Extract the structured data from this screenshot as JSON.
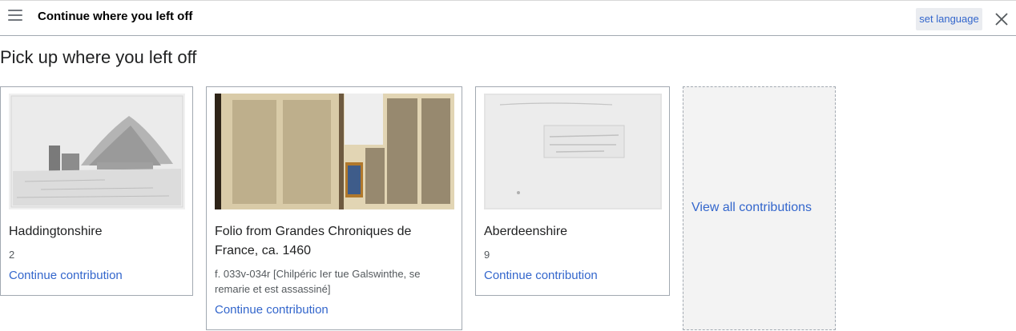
{
  "header": {
    "title": "Continue where you left off",
    "language_button": "set language"
  },
  "main": {
    "heading": "Pick up where you left off",
    "cards": [
      {
        "title": "Haddingtonshire",
        "meta": "2",
        "link": "Continue contribution"
      },
      {
        "title": "Folio from Grandes Chroniques de France, ca. 1460",
        "meta": "f. 033v-034r [Chilpéric Ier tue Galswinthe, se remarie et est assassiné]",
        "link": "Continue contribution"
      },
      {
        "title": "Aberdeenshire",
        "meta": "9",
        "link": "Continue contribution"
      }
    ],
    "view_all": "View all contributions"
  },
  "icons": {
    "menu": "hamburger-menu-icon",
    "close": "close-icon"
  }
}
